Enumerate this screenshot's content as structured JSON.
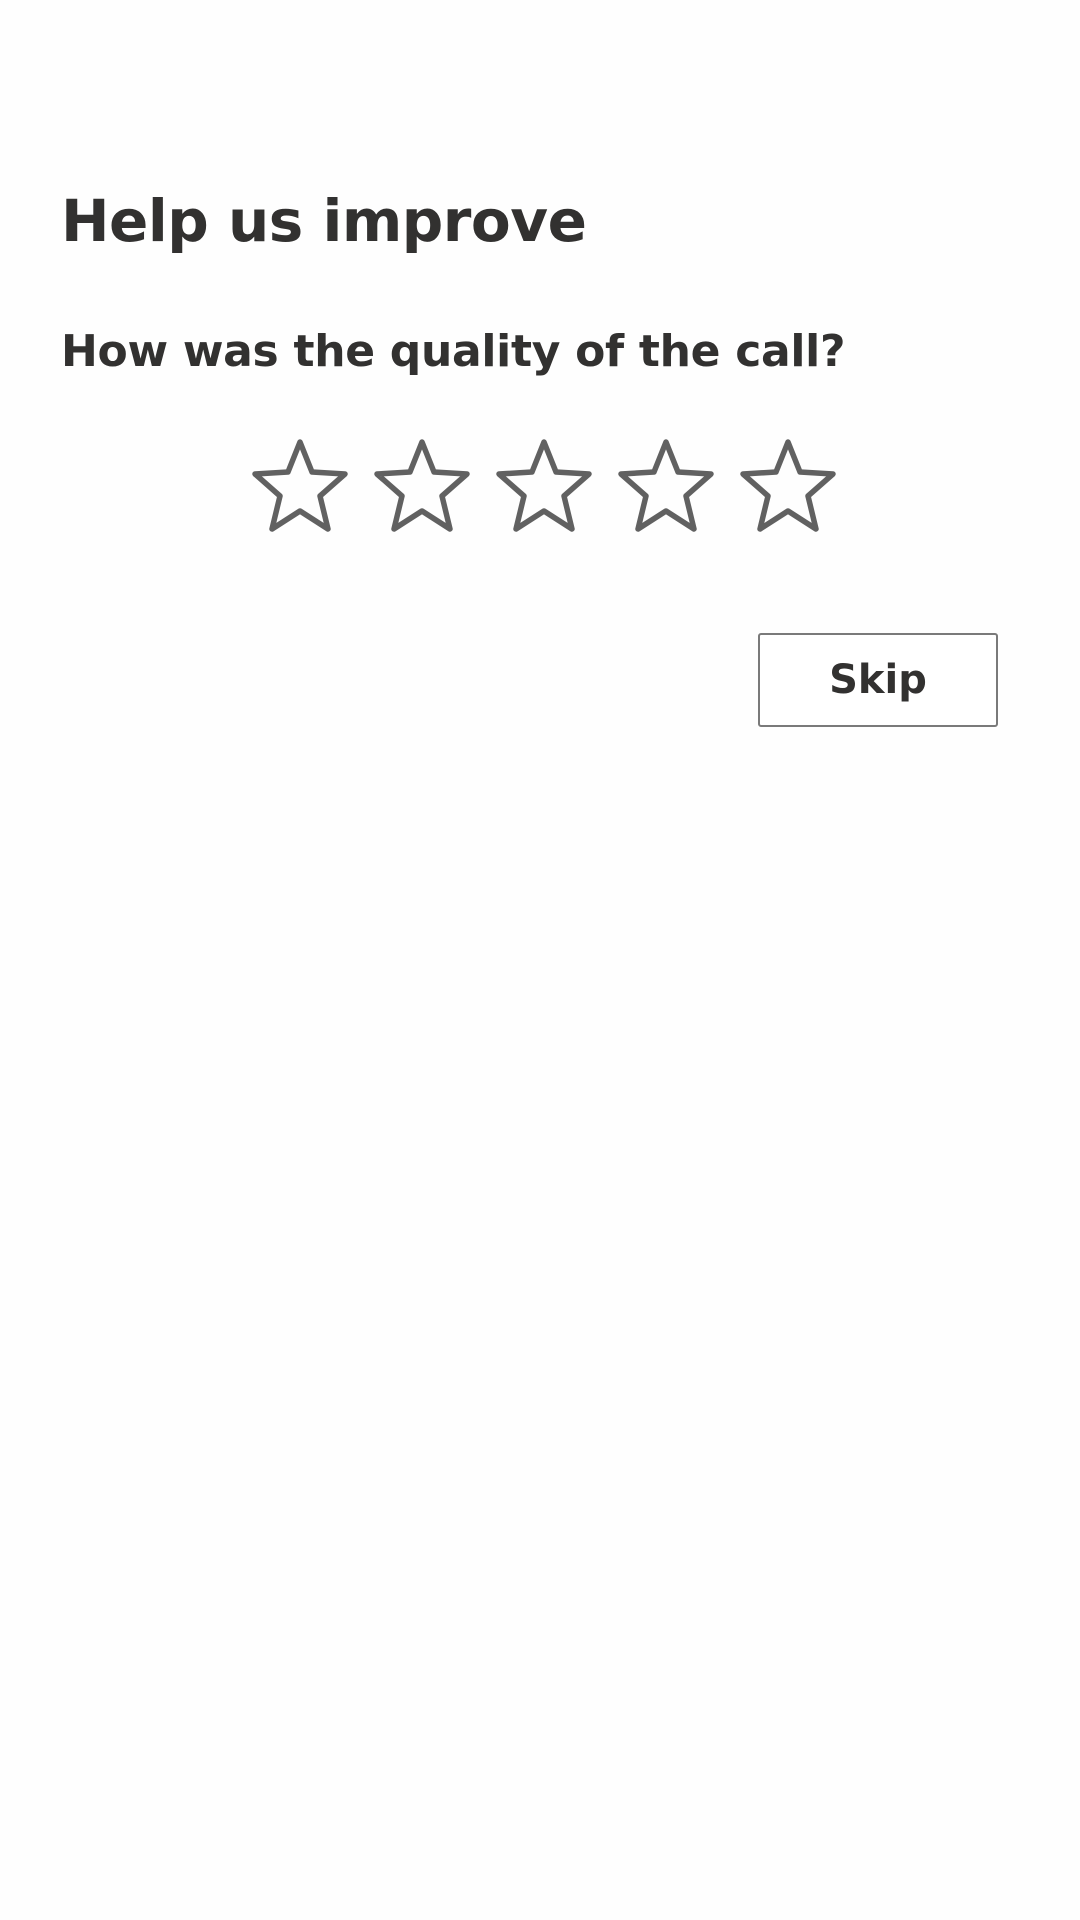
{
  "header": {
    "title": "Help us improve"
  },
  "survey": {
    "question": "How was the quality of the call?",
    "rating": {
      "max": 5,
      "selected": 0,
      "star_outline_color": "#616161"
    },
    "skip_label": "Skip"
  },
  "colors": {
    "text": "#323130",
    "background": "#fefefe",
    "button_border": "#7a7a7a"
  }
}
